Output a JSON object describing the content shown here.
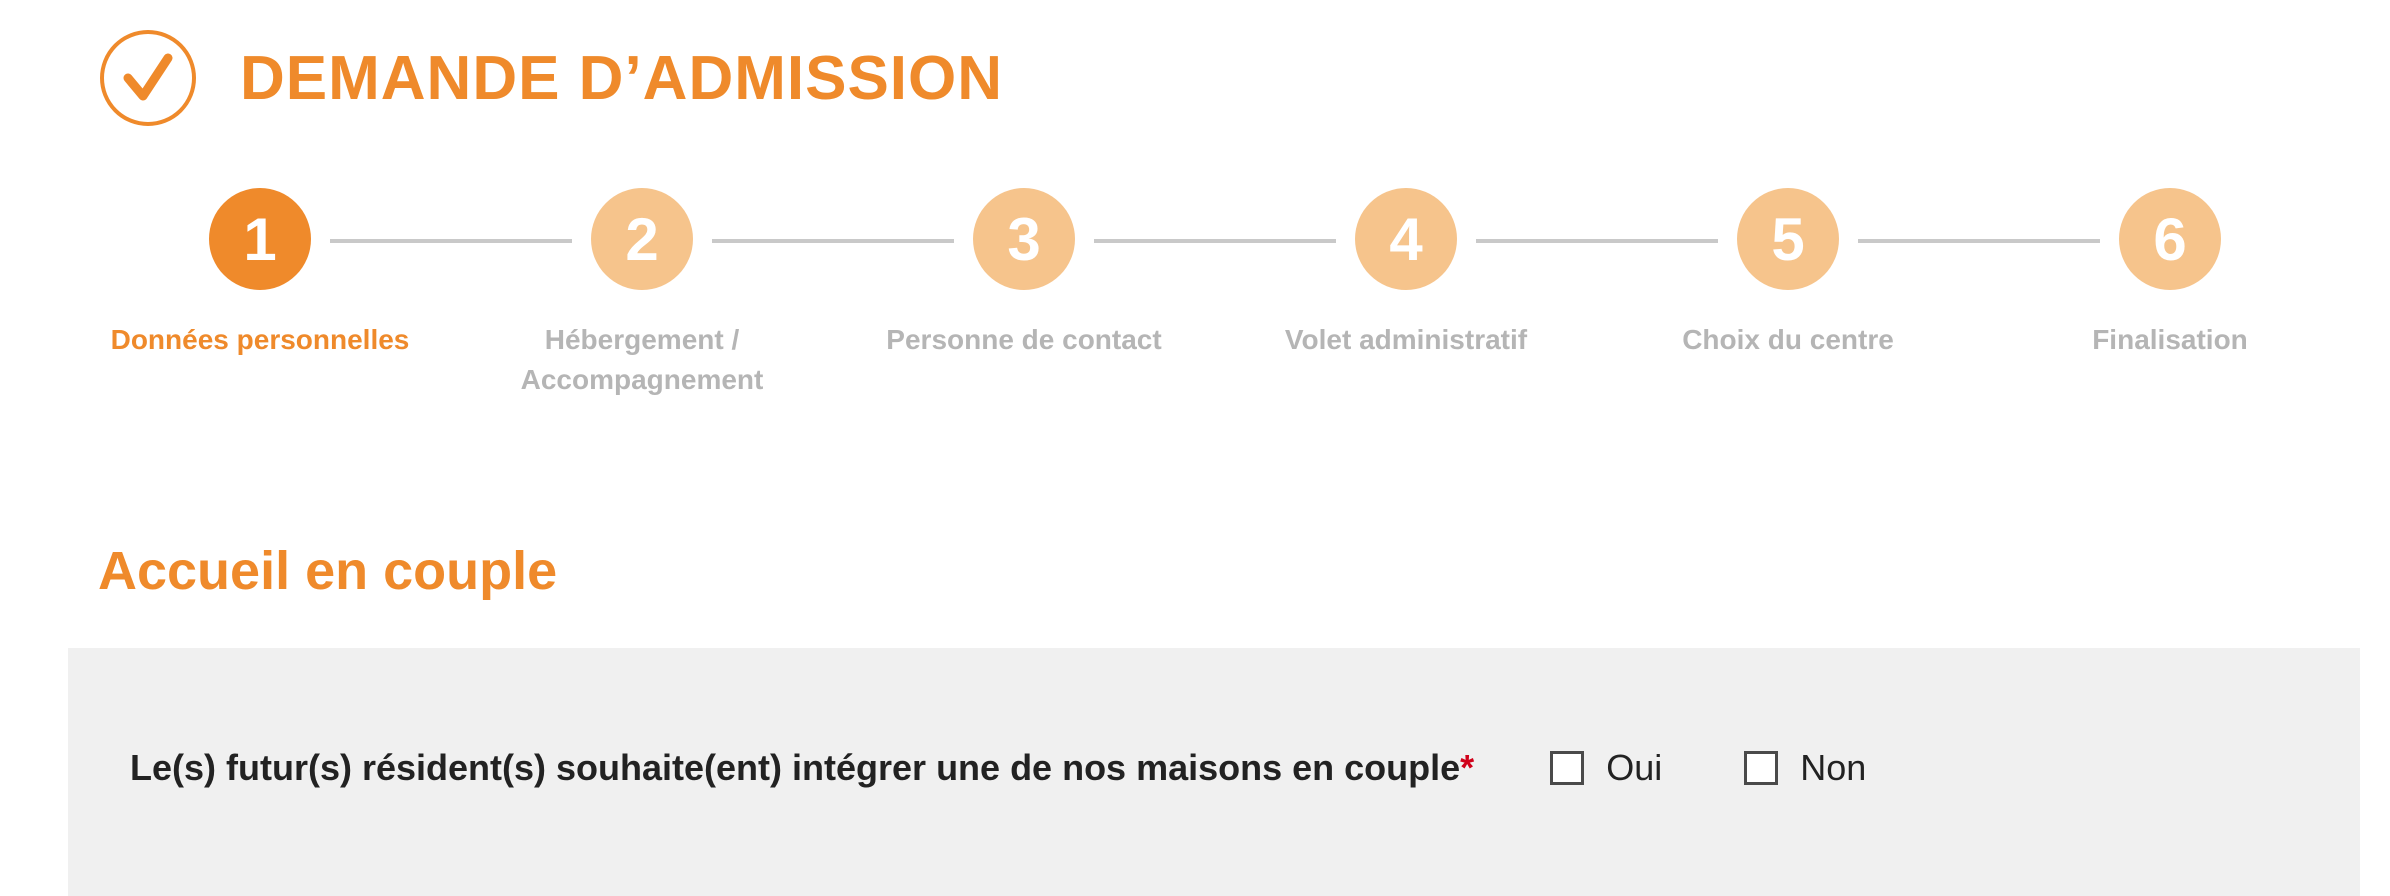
{
  "header": {
    "icon": "check-circle-icon",
    "title": "DEMANDE D’ADMISSION"
  },
  "stepper": {
    "active_step": 1,
    "steps": [
      {
        "number": "1",
        "label": "Données personnelles"
      },
      {
        "number": "2",
        "label": "Hébergement / Accompagnement"
      },
      {
        "number": "3",
        "label": "Personne de contact"
      },
      {
        "number": "4",
        "label": "Volet administratif"
      },
      {
        "number": "5",
        "label": "Choix du centre"
      },
      {
        "number": "6",
        "label": "Finalisation"
      }
    ]
  },
  "section": {
    "title": "Accueil en couple",
    "question": {
      "text": "Le(s) futur(s) résident(s) souhaite(ent) intégrer une de nos maisons en couple",
      "required_mark": "*",
      "options": [
        {
          "label": "Oui",
          "checked": false
        },
        {
          "label": "Non",
          "checked": false
        }
      ]
    }
  },
  "colors": {
    "accent": "#ef8a2b",
    "accent_light": "#f6c48c",
    "inactive_text": "#b5b5b5",
    "required": "#d0021b",
    "panel_bg": "#f0f0f0"
  }
}
